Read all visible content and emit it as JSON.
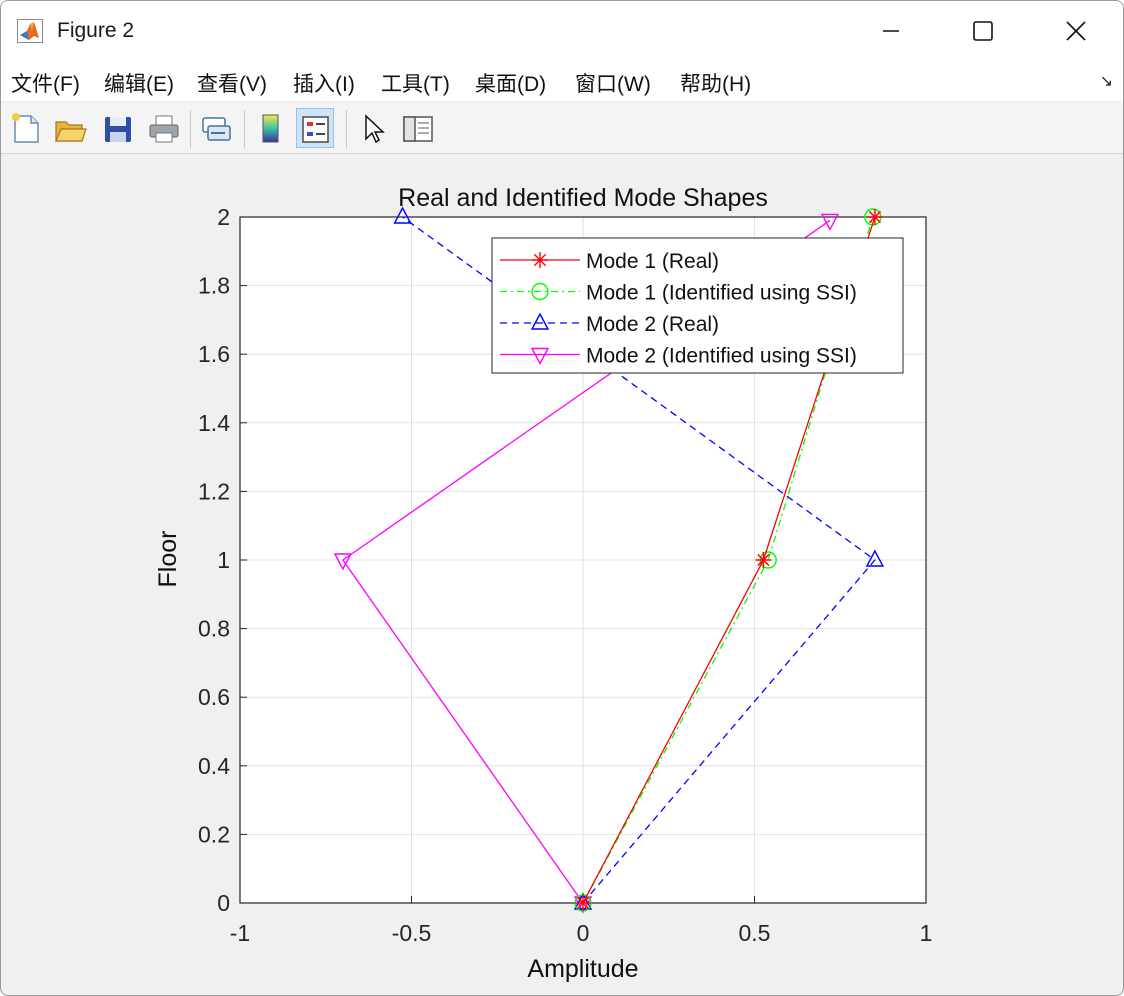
{
  "window": {
    "title": "Figure 2"
  },
  "menu": {
    "items": [
      "文件(F)",
      "编辑(E)",
      "查看(V)",
      "插入(I)",
      "工具(T)",
      "桌面(D)",
      "窗口(W)",
      "帮助(H)"
    ]
  },
  "toolbar": {
    "icons": [
      "new-figure-icon",
      "open-file-icon",
      "save-icon",
      "print-icon",
      "link-plot-icon",
      "insert-colorbar-icon",
      "insert-legend-icon",
      "edit-plot-icon",
      "property-inspector-icon"
    ]
  },
  "chart_data": {
    "type": "line",
    "title": "Real and Identified Mode Shapes",
    "xlabel": "Amplitude",
    "ylabel": "Floor",
    "xlim": [
      -1,
      1
    ],
    "ylim": [
      0,
      2
    ],
    "xticks": [
      "-1",
      "-0.5",
      "0",
      "0.5",
      "1"
    ],
    "yticks": [
      "0",
      "0.2",
      "0.4",
      "0.6",
      "0.8",
      "1",
      "1.2",
      "1.4",
      "1.6",
      "1.8",
      "2"
    ],
    "grid": true,
    "legend_position": "top-right",
    "series": [
      {
        "name": "Mode 1 (Real)",
        "color": "#ff0000",
        "dash": "solid",
        "marker": "asterisk",
        "points": [
          [
            0,
            0
          ],
          [
            0.526,
            1
          ],
          [
            0.851,
            2
          ]
        ]
      },
      {
        "name": "Mode 1 (Identified using SSI)",
        "color": "#00ff00",
        "dash": "dashdot",
        "marker": "circle",
        "points": [
          [
            0,
            0
          ],
          [
            0.54,
            1
          ],
          [
            0.845,
            2
          ]
        ]
      },
      {
        "name": "Mode 2 (Real)",
        "color": "#0000ff",
        "dash": "dashed",
        "marker": "triangle-up",
        "points": [
          [
            0,
            0
          ],
          [
            0.851,
            1
          ],
          [
            -0.526,
            2
          ]
        ]
      },
      {
        "name": "Mode 2 (Identified using SSI)",
        "color": "#ff00ff",
        "dash": "solid",
        "marker": "triangle-down",
        "points": [
          [
            0,
            0
          ],
          [
            -0.7,
            1
          ],
          [
            0.72,
            1.99
          ]
        ]
      }
    ]
  }
}
